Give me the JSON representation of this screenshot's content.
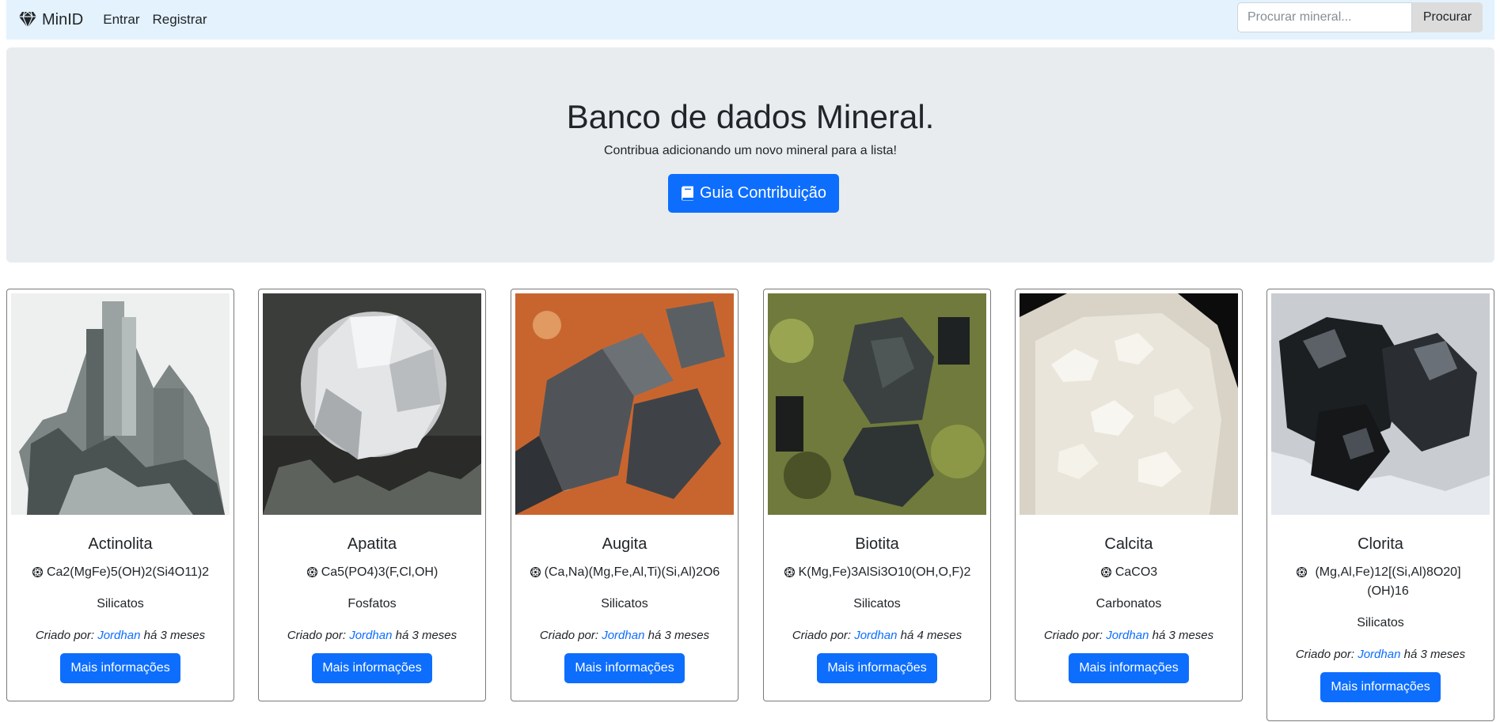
{
  "navbar": {
    "brand": "MinID",
    "brand_icon": "gem-icon",
    "links": [
      "Entrar",
      "Registrar"
    ],
    "search_placeholder": "Procurar mineral...",
    "search_button": "Procurar"
  },
  "hero": {
    "title": "Banco de dados Mineral.",
    "subtitle": "Contribua adicionando um novo mineral para a lista!",
    "button_label": "Guia Contribuição",
    "button_icon": "book-icon"
  },
  "labels": {
    "created_by": "Criado por:",
    "more_info": "Mais informações"
  },
  "formula_icon": "atom-icon",
  "colors": {
    "primary": "#0d6efd",
    "navbar_bg": "#e3f2fd",
    "hero_bg": "#e9ecef",
    "search_button_bg": "#dcdcdc"
  },
  "minerals": [
    {
      "name": "Actinolita",
      "formula": "Ca2(MgFe)5(OH)2(Si4O11)2",
      "category": "Silicatos",
      "author": "Jordhan",
      "time": "há 3 meses"
    },
    {
      "name": "Apatita",
      "formula": "Ca5(PO4)3(F,Cl,OH)",
      "category": "Fosfatos",
      "author": "Jordhan",
      "time": "há 3 meses"
    },
    {
      "name": "Augita",
      "formula": "(Ca,Na)(Mg,Fe,Al,Ti)(Si,Al)2O6",
      "category": "Silicatos",
      "author": "Jordhan",
      "time": "há 3 meses"
    },
    {
      "name": "Biotita",
      "formula": "K(Mg,Fe)3AlSi3O10(OH,O,F)2",
      "category": "Silicatos",
      "author": "Jordhan",
      "time": "há 4 meses"
    },
    {
      "name": "Calcita",
      "formula": "CaCO3",
      "category": "Carbonatos",
      "author": "Jordhan",
      "time": "há 3 meses"
    },
    {
      "name": "Clorita",
      "formula": "(Mg,Al,Fe)12[(Si,Al)8O20](OH)16",
      "category": "Silicatos",
      "author": "Jordhan",
      "time": "há 3 meses"
    }
  ]
}
